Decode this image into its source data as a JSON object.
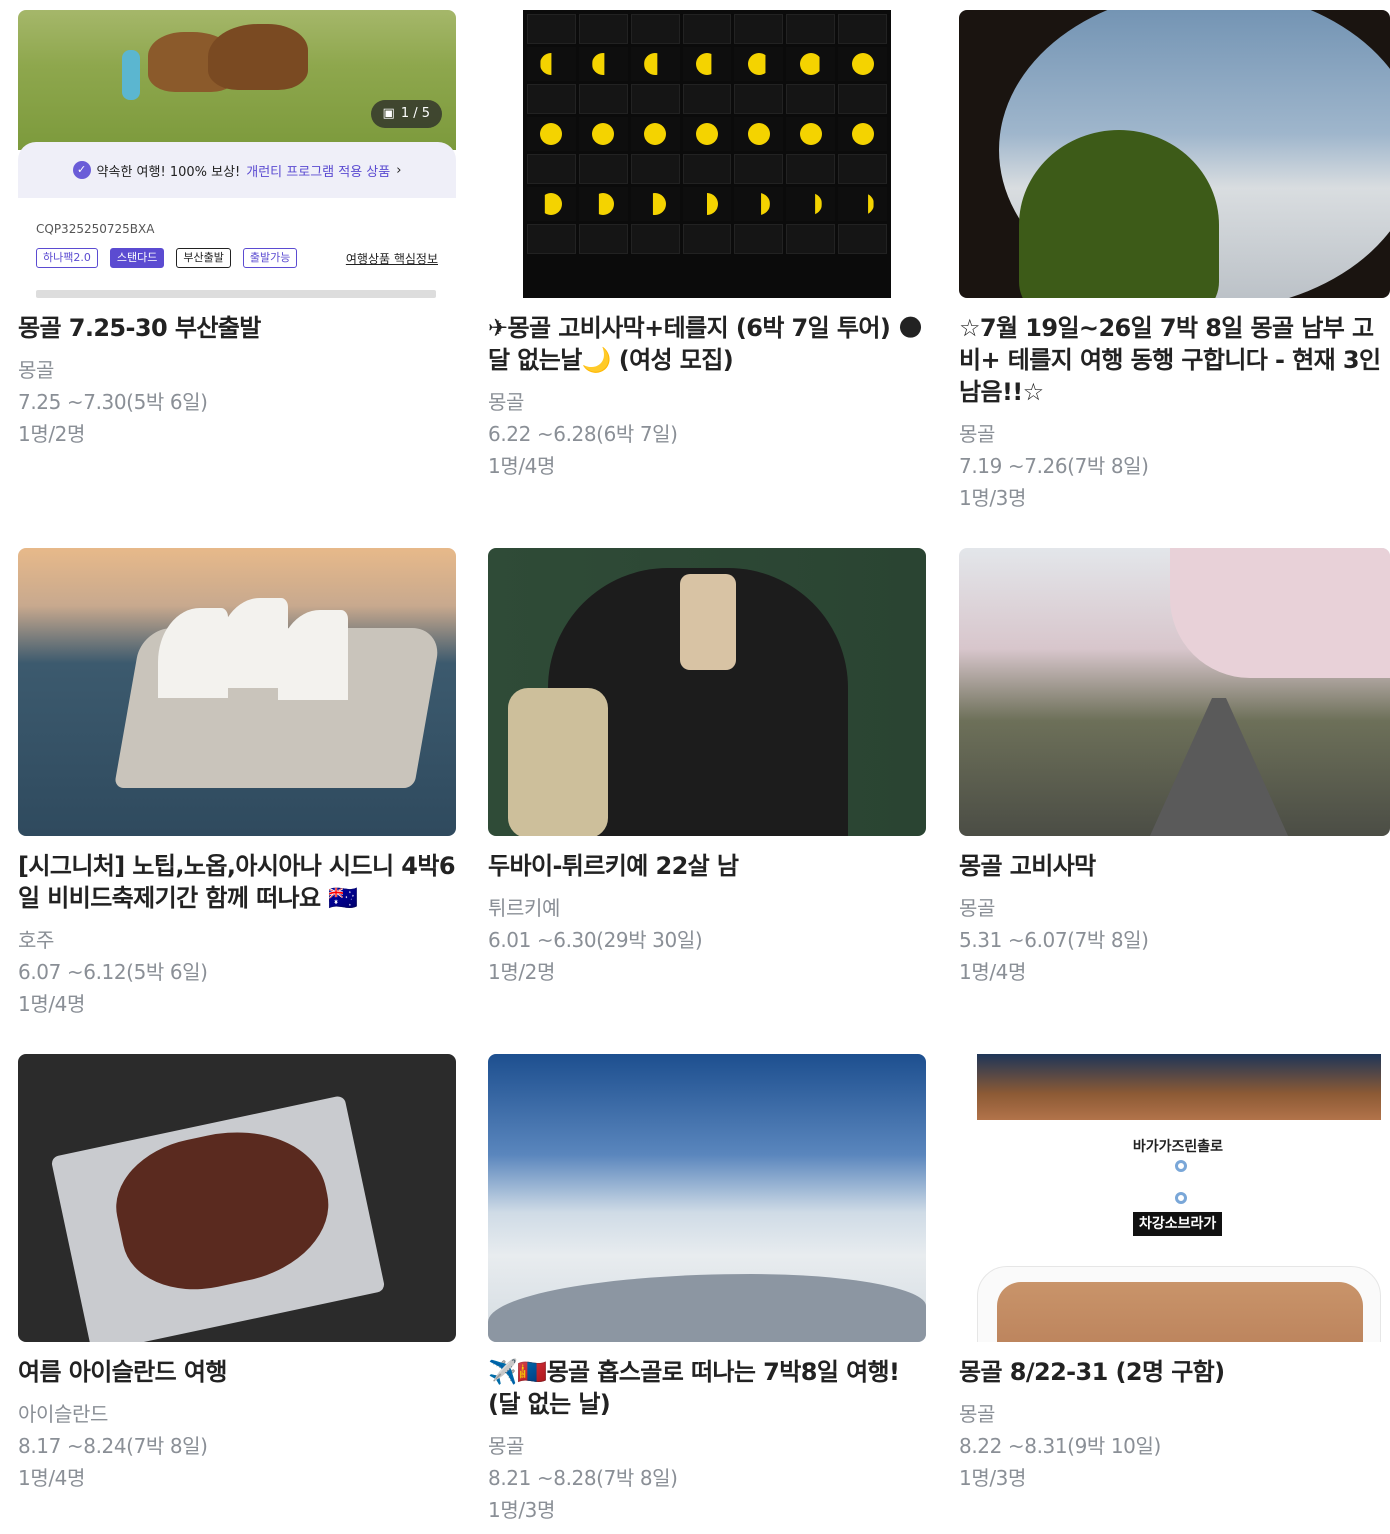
{
  "cards": [
    {
      "title": "몽골 7.25-30 부산출발",
      "location": "몽골",
      "dates": "7.25 ~7.30(5박 6일)",
      "people": "1명/2명",
      "thumb": {
        "counter": "1 / 5",
        "banner_prefix": "약속한 여행! 100% 보상!",
        "banner_highlight": "개런티 프로그램 적용 상품",
        "banner_arrow": "›",
        "code": "CQP325250725BXA",
        "tags": [
          "하나팩2.0",
          "스탠다드",
          "부산출발",
          "출발가능"
        ],
        "info_link": "여행상품 핵심정보"
      }
    },
    {
      "title": "✈몽골 고비사막+테를지 (6박 7일 투어) 🌑달 없는날🌙 (여성 모집)",
      "location": "몽골",
      "dates": "6.22 ~6.28(6박 7일)",
      "people": "1명/4명"
    },
    {
      "title": "☆7월 19일~26일 7박 8일 몽골 남부 고비+ 테를지 여행 동행 구합니다 - 현재 3인 남음!!☆",
      "location": "몽골",
      "dates": "7.19 ~7.26(7박 8일)",
      "people": "1명/3명"
    },
    {
      "title": "[시그니처] 노팁,노옵,아시아나 시드니 4박6일 비비드축제기간 함께 떠나요 🇦🇺",
      "location": "호주",
      "dates": "6.07 ~6.12(5박 6일)",
      "people": "1명/4명"
    },
    {
      "title": "두바이-튀르키예 22살 남",
      "location": "튀르키예",
      "dates": "6.01 ~6.30(29박 30일)",
      "people": "1명/2명"
    },
    {
      "title": "몽골 고비사막",
      "location": "몽골",
      "dates": "5.31 ~6.07(7박 8일)",
      "people": "1명/4명"
    },
    {
      "title": "여름 아이슬란드 여행",
      "location": "아이슬란드",
      "dates": "8.17 ~8.24(7박 8일)",
      "people": "1명/4명"
    },
    {
      "title": "✈️🇲🇳몽골 홉스골로 떠나는 7박8일 여행! (달 없는 날)",
      "location": "몽골",
      "dates": "8.21 ~8.28(7박 8일)",
      "people": "1명/3명"
    },
    {
      "title": "몽골 8/22-31 (2명 구함)",
      "location": "몽골",
      "dates": "8.22 ~8.31(9박 10일)",
      "people": "1명/3명",
      "thumb": {
        "stop1": "바가가즈린촐로",
        "stop2": "차강소브라가"
      }
    }
  ]
}
